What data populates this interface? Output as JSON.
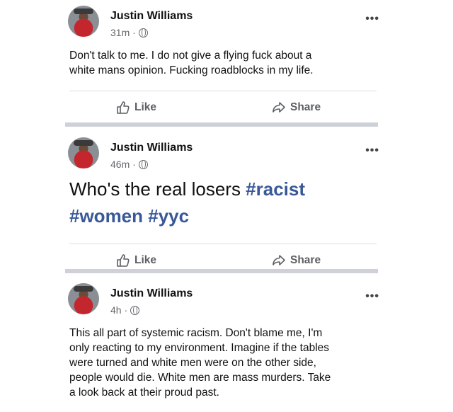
{
  "posts": [
    {
      "author": "Justin Williams",
      "time": "31m ·",
      "text": "Don't talk to me. I do not give a flying fuck about a\nwhite mans opinion. Fucking roadblocks in my life.",
      "like": "Like",
      "share": "Share"
    },
    {
      "author": "Justin Williams",
      "time": "46m ·",
      "text_plain": "Who's the real losers ",
      "hashtags": [
        "#racist",
        "#women",
        "#yyc"
      ],
      "like": "Like",
      "share": "Share"
    },
    {
      "author": "Justin Williams",
      "time": "4h ·",
      "text": "This all part of systemic racism. Don't blame me, I'm\nonly reacting to my environment. Imagine if the tables\nwere turned and white men were on the other side,\npeople would die. White men are mass murders. Take\na look back at their proud past."
    }
  ],
  "more": "•••",
  "colors": {
    "hashtag": "#385898",
    "separator": "#ced2d8"
  }
}
